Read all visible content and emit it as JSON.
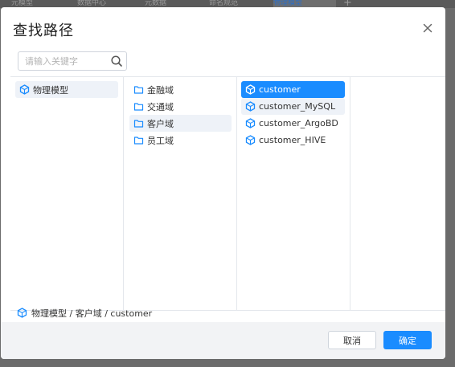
{
  "background": {
    "tabs": [
      {
        "label": "元模型"
      },
      {
        "label": "数据中心"
      },
      {
        "label": "元数据"
      },
      {
        "label": "命名规范"
      },
      {
        "label": "物理模型"
      }
    ],
    "plus": "+"
  },
  "dialog": {
    "title": "查找路径",
    "search_placeholder": "请输入关键字",
    "columns": [
      {
        "items": [
          {
            "label": "物理模型",
            "icon": "model-icon"
          }
        ]
      },
      {
        "items": [
          {
            "label": "金融域",
            "icon": "folder-icon"
          },
          {
            "label": "交通域",
            "icon": "folder-icon"
          },
          {
            "label": "客户域",
            "icon": "folder-icon"
          },
          {
            "label": "员工域",
            "icon": "folder-icon"
          }
        ]
      },
      {
        "items": [
          {
            "label": "customer",
            "icon": "model-icon"
          },
          {
            "label": "customer_MySQL",
            "icon": "model-icon"
          },
          {
            "label": "customer_ArgoBD",
            "icon": "model-icon"
          },
          {
            "label": "customer_HIVE",
            "icon": "model-icon"
          }
        ]
      },
      {
        "items": []
      }
    ],
    "path": "物理模型 / 客户域 / customer",
    "cancel_label": "取消",
    "ok_label": "确定"
  },
  "colors": {
    "accent": "#1a8cff",
    "highlight": "#eef2f8",
    "overlay": "#6b6b6b",
    "footer": "#f2f3f5"
  }
}
